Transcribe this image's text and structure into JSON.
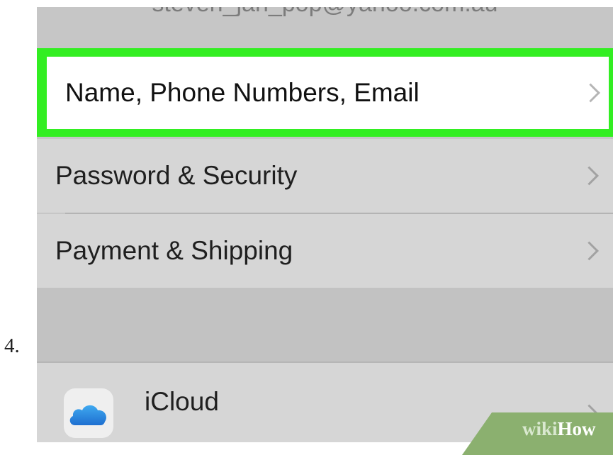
{
  "step": {
    "number": "4."
  },
  "header": {
    "account_email": "steven_jan_pop@yahoo.com.au"
  },
  "settings_rows": [
    {
      "label": "Name, Phone Numbers, Email",
      "highlighted": true
    },
    {
      "label": "Password & Security",
      "highlighted": false
    },
    {
      "label": "Payment & Shipping",
      "highlighted": false
    }
  ],
  "services": [
    {
      "label": "iCloud",
      "icon": "icloud-icon"
    }
  ],
  "watermark": {
    "prefix": "wiki",
    "suffix": "How"
  },
  "colors": {
    "highlight": "#33ee22",
    "background": "#c6c6c6",
    "row": "#d6d6d6"
  }
}
